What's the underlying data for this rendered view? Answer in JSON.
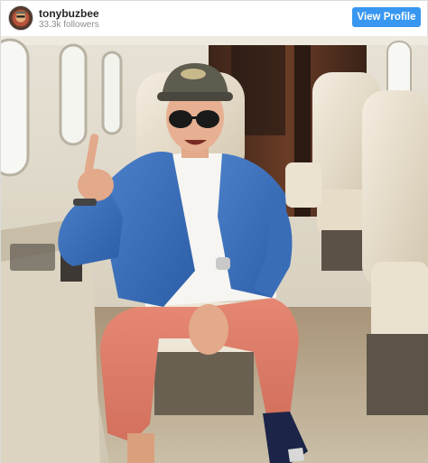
{
  "header": {
    "username": "tonybuzbee",
    "followers": "33.3k followers",
    "view_profile_label": "View Profile"
  },
  "icons": {
    "avatar": "profile-avatar"
  },
  "colors": {
    "button": "#3897f0",
    "username": "#262626",
    "secondary_text": "#8e8e8e"
  }
}
